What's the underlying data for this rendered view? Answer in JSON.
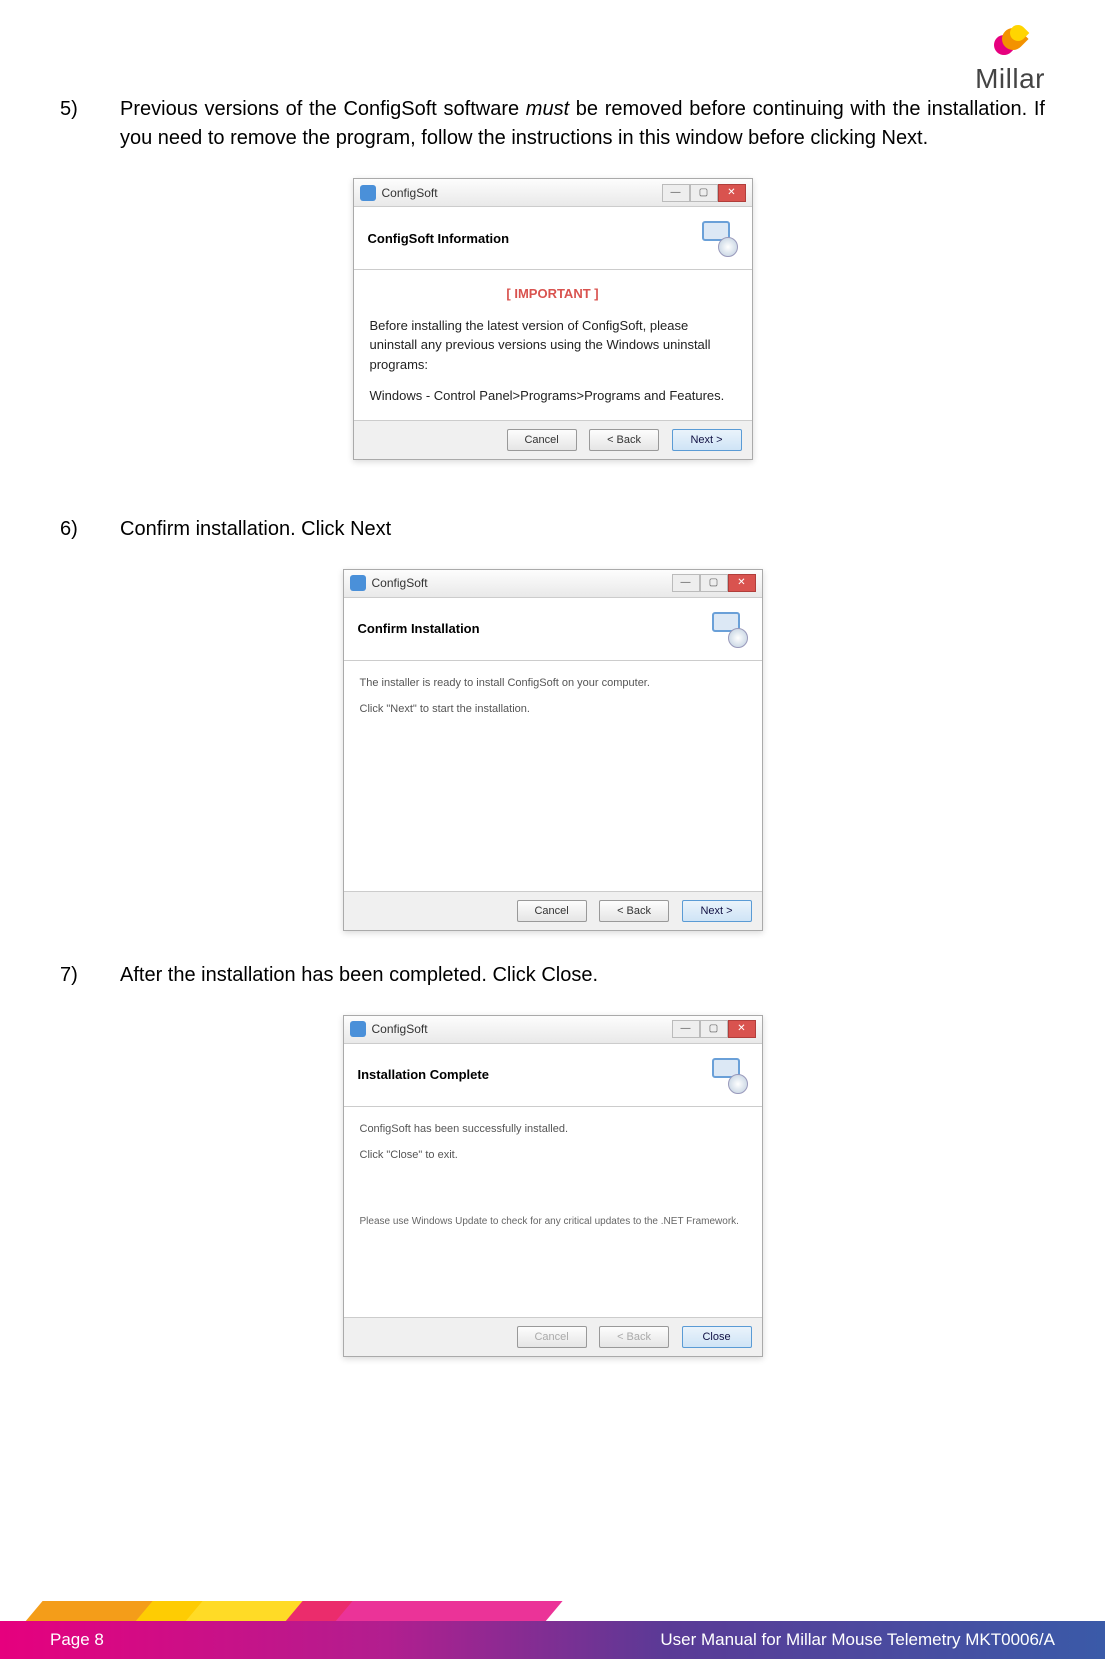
{
  "logo": {
    "brand": "Millar"
  },
  "steps": {
    "s5": {
      "num": "5)",
      "text_a": "Previous versions of the ConfigSoft software ",
      "text_em": "must",
      "text_b": " be removed before continuing with the installation.  If you need to remove the program, follow the instructions in this window before clicking Next."
    },
    "s6": {
      "num": "6)",
      "text": "Confirm installation.  Click Next"
    },
    "s7": {
      "num": "7)",
      "text": "After the installation has been completed.  Click Close."
    }
  },
  "win1": {
    "title": "ConfigSoft",
    "banner": "ConfigSoft Information",
    "important": "[ IMPORTANT ]",
    "para1": "Before installing the latest version of ConfigSoft, please uninstall any previous versions using the Windows uninstall programs:",
    "para2": "Windows - Control Panel>Programs>Programs and Features.",
    "btn_cancel": "Cancel",
    "btn_back": "< Back",
    "btn_next": "Next >"
  },
  "win2": {
    "title": "ConfigSoft",
    "banner": "Confirm Installation",
    "line1": "The installer is ready to install ConfigSoft on your computer.",
    "line2": "Click \"Next\" to start the installation.",
    "btn_cancel": "Cancel",
    "btn_back": "< Back",
    "btn_next": "Next >"
  },
  "win3": {
    "title": "ConfigSoft",
    "banner": "Installation Complete",
    "line1": "ConfigSoft has been successfully installed.",
    "line2": "Click \"Close\" to exit.",
    "note": "Please use Windows Update to check for any critical updates to the .NET Framework.",
    "btn_cancel": "Cancel",
    "btn_back": "< Back",
    "btn_close": "Close"
  },
  "footer": {
    "page": "Page 8",
    "doc": "User Manual for Millar Mouse Telemetry MKT0006/A"
  }
}
